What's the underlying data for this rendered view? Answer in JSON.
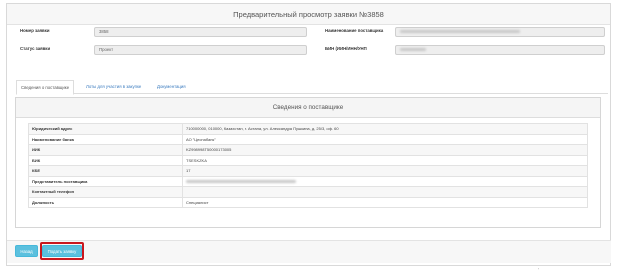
{
  "header": {
    "title": "Предварительный просмотр заявки №3858"
  },
  "form": {
    "number_label": "Номер заявки",
    "number_value": "3858",
    "status_label": "Статус заявки",
    "status_value": "Проект",
    "supplier_label": "Наименование поставщика",
    "bin_label": "БИН (ИИН/ИНН/УНП"
  },
  "tabs": [
    {
      "label": "Сведения о поставщике",
      "active": true
    },
    {
      "label": "Лоты для участия в закупке",
      "active": false
    },
    {
      "label": "Документация",
      "active": false
    }
  ],
  "panel": {
    "title": "Сведения о поставщике",
    "rows": [
      {
        "key": "Юридический адрес",
        "value": "710000000, 010000, Казахстан, г. Астана, ул. Александра Пушкина, д. 25/3, оф. 60"
      },
      {
        "key": "Наименование банка",
        "value": "АО \"Цеснабанк\""
      },
      {
        "key": "ИИК",
        "value": "KZ998998T50000173005"
      },
      {
        "key": "БИК",
        "value": "TSESKZKA"
      },
      {
        "key": "КБЕ",
        "value": "17"
      },
      {
        "key": "Представитель поставщика",
        "value": ""
      },
      {
        "key": "Контактный телефон",
        "value": ""
      },
      {
        "key": "Должность",
        "value": "Специалист"
      }
    ]
  },
  "footer": {
    "back_label": "Назад",
    "submit_label": "Подать заявку"
  },
  "colors": {
    "accent": "#5bc0de",
    "highlight": "#c9171e",
    "link": "#3a7bbf"
  }
}
